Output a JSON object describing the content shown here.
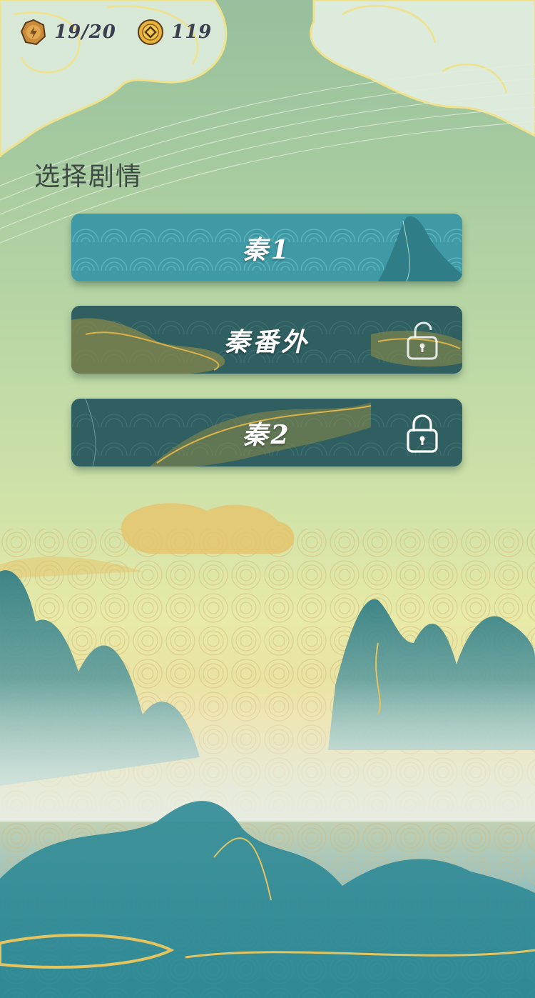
{
  "hud": {
    "energy": "19/20",
    "coins": "119"
  },
  "page_title": "选择剧情",
  "stories": [
    {
      "label": "秦1",
      "locked": false,
      "lock_icon": ""
    },
    {
      "label": "秦番外",
      "locked": true,
      "lock_icon": "unlocked-padlock-icon"
    },
    {
      "label": "秦2",
      "locked": true,
      "lock_icon": "padlock-icon"
    }
  ],
  "colors": {
    "button_teal": "#3f9aa6",
    "button_dark": "#2f5f61",
    "gold": "#d9b24a",
    "mountain": "#2f7f88"
  }
}
